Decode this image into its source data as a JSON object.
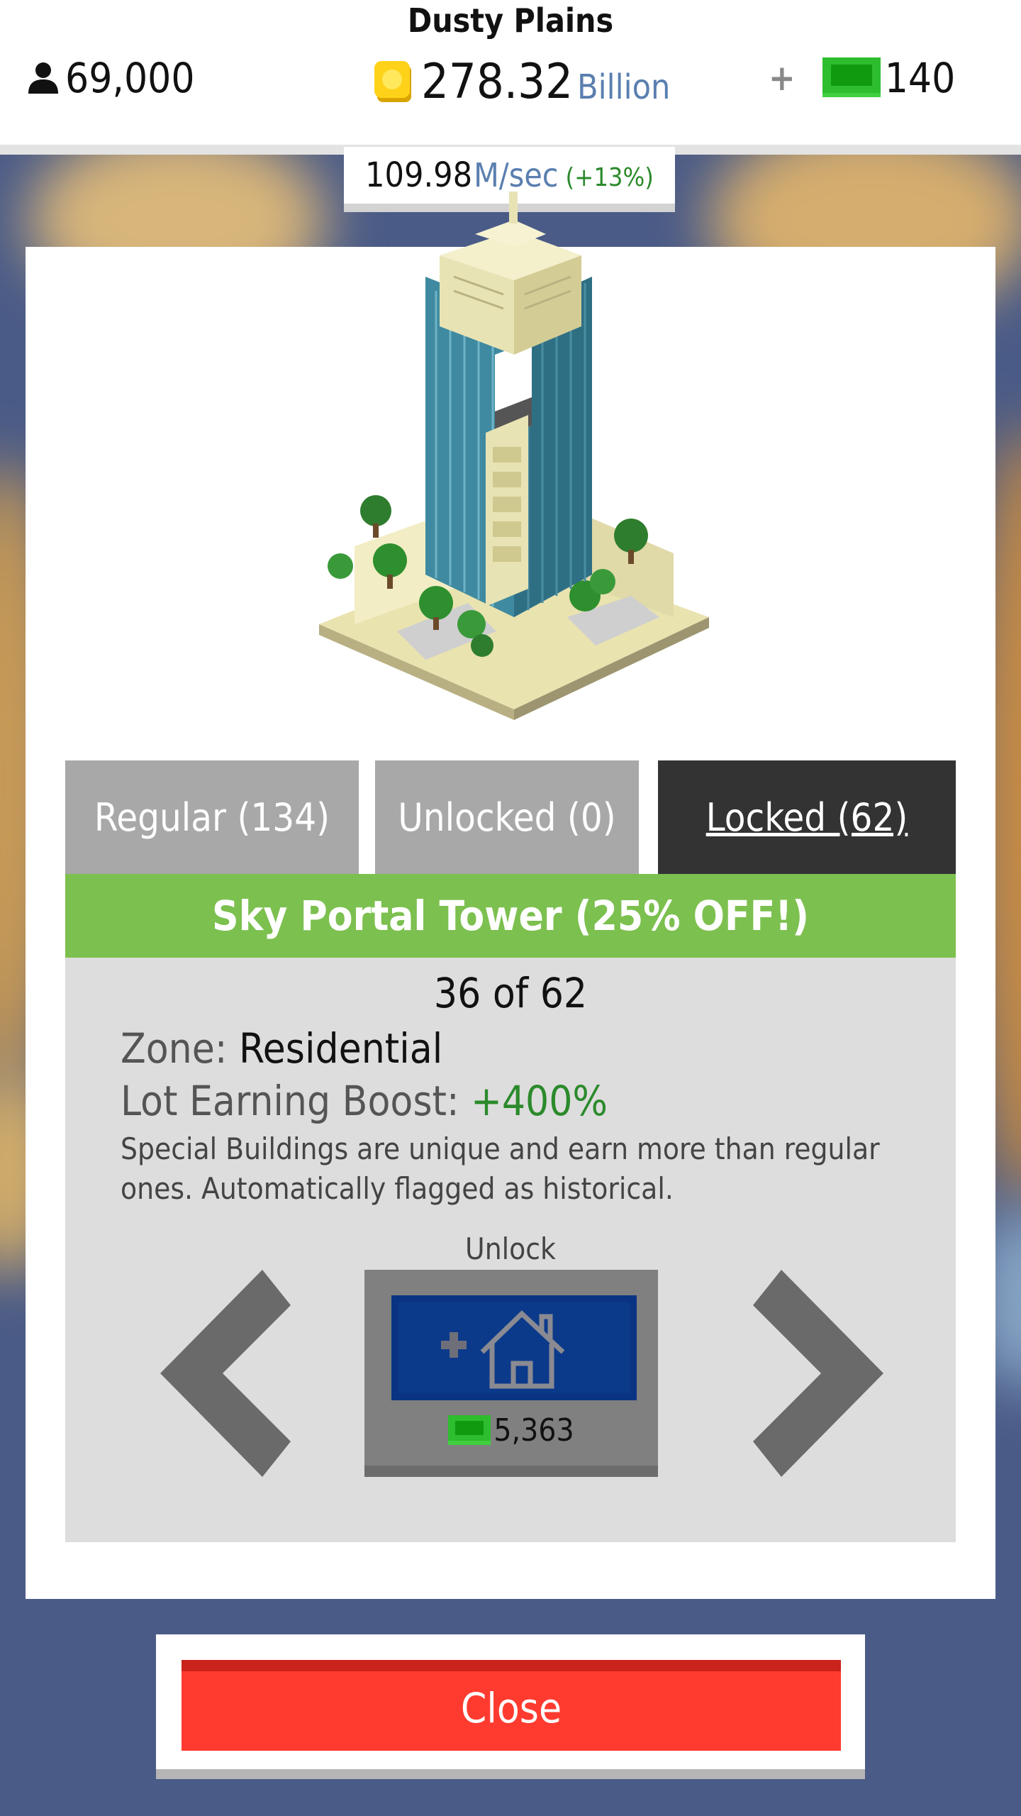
{
  "header": {
    "city_name": "Dusty Plains",
    "population": "69,000",
    "money_value": "278.32",
    "money_unit": "Billion",
    "cash_plus": "+",
    "cash_value": "140",
    "rate_value": "109.98",
    "rate_unit": "M/sec",
    "rate_bonus": "(+13%)"
  },
  "tabs": [
    {
      "label": "Regular (134)"
    },
    {
      "label": "Unlocked (0)"
    },
    {
      "label": "Locked (62)",
      "active": true
    }
  ],
  "building": {
    "title": "Sky Portal Tower (25% OFF!)",
    "counter": "36 of 62",
    "zone_label": "Zone:",
    "zone_value": "Residential",
    "boost_label": "Lot Earning Boost:",
    "boost_value": "+400%",
    "description": "Special Buildings are unique and earn more than regular ones. Automatically flagged as historical."
  },
  "unlock": {
    "label": "Unlock",
    "price": "5,363"
  },
  "close_label": "Close",
  "icons": [
    "person-icon",
    "coin-icon",
    "cash-icon",
    "house-plus-icon",
    "prev-arrow-icon",
    "next-arrow-icon",
    "building-image"
  ],
  "colors": {
    "title_bar": "#7cc04f",
    "active_tab": "#333333",
    "close_button": "#ff3b2f",
    "unlock_inner": "#0c3a8a",
    "boost_text": "#2b8a2b",
    "rate_unit": "#5a7fb0"
  }
}
